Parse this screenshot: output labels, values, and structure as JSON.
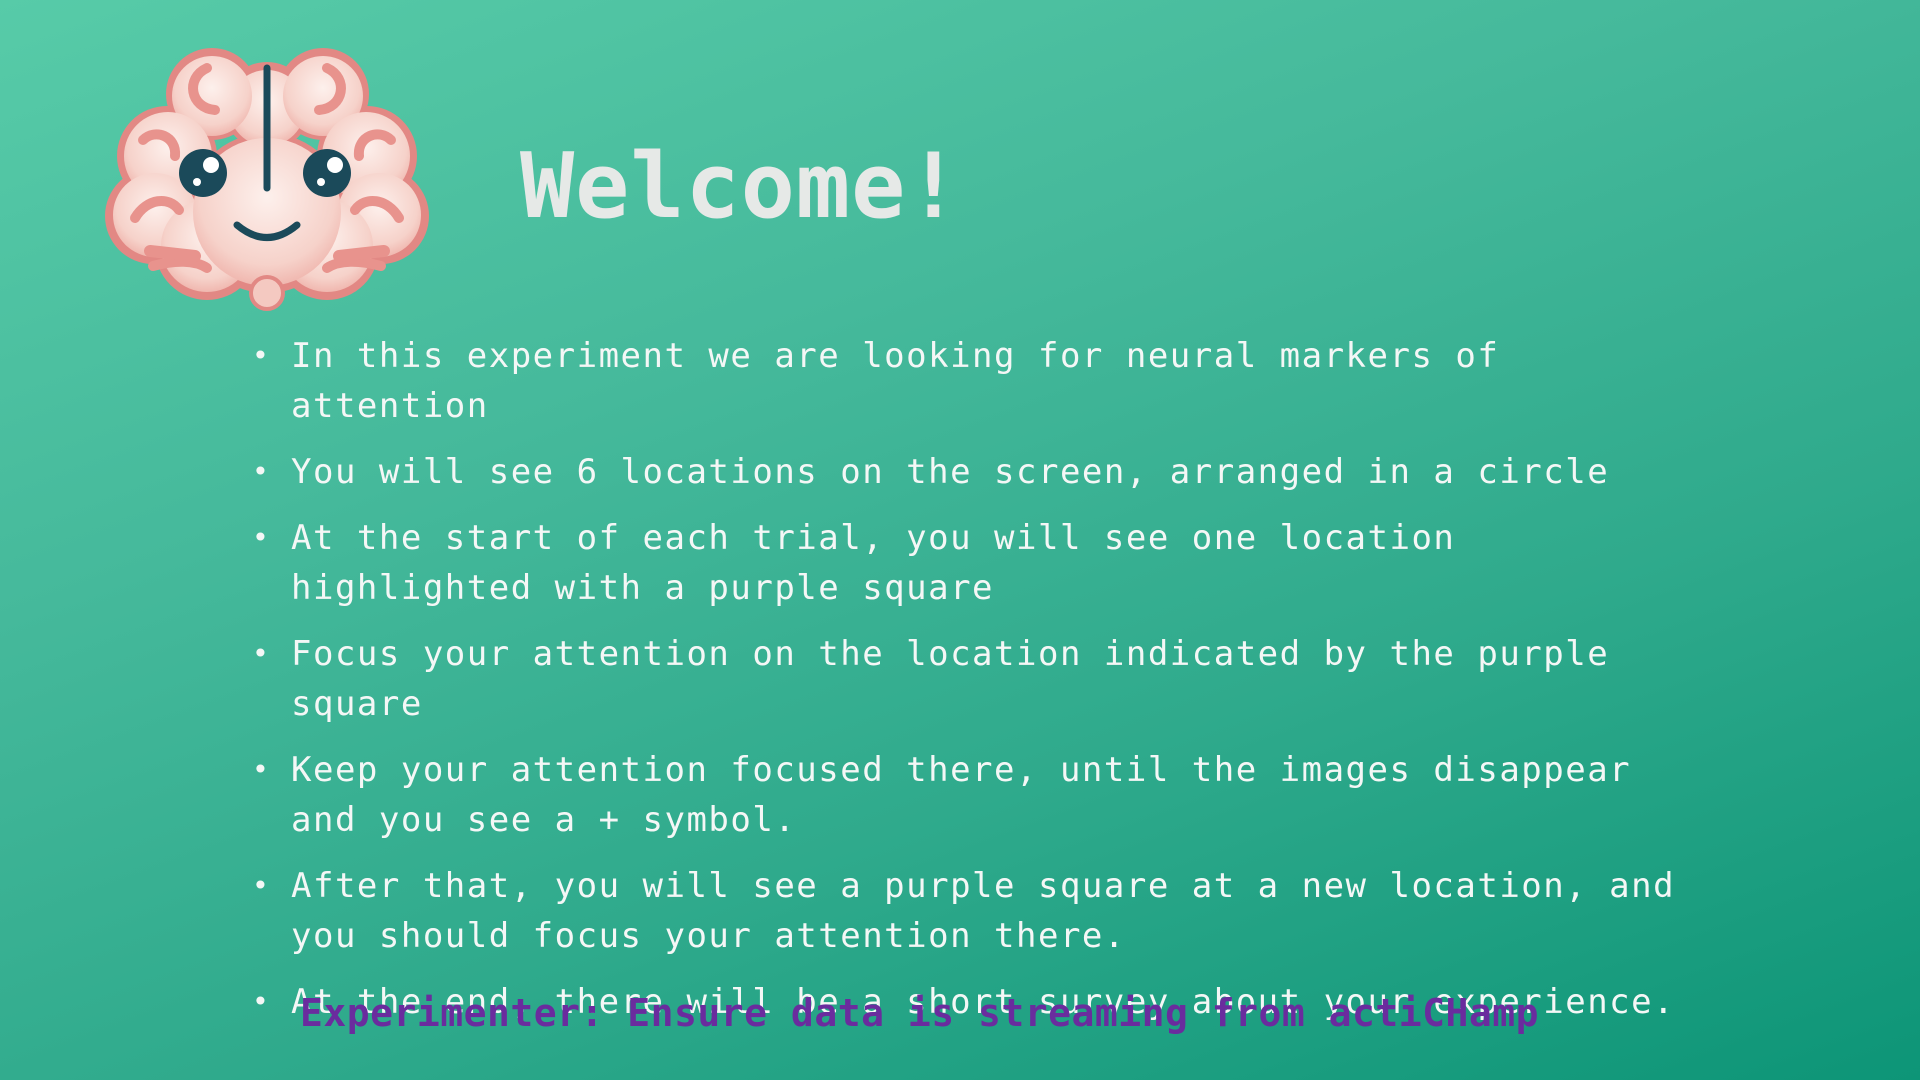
{
  "page": {
    "title": "Welcome!",
    "mascot_icon": "brain-mascot-icon",
    "instructions": [
      {
        "text": "In this experiment we are looking for neural markers of attention"
      },
      {
        "text": "You will see 6 locations on the screen, arranged in a circle"
      },
      {
        "text": "At the start of each trial, you will see one location highlighted with a purple square"
      },
      {
        "text": "Focus your attention on the location indicated by the purple square"
      },
      {
        "text": "Keep your attention focused there, until the images disappear and you see a + symbol."
      },
      {
        "text": "After that, you will see a purple square at a new location, and you should focus your attention there."
      },
      {
        "text": "At the end, there will be a short survey about your experience."
      }
    ],
    "experimenter_notice": "Experimenter: Ensure data is streaming from actiCHamp"
  },
  "colors": {
    "background_start": "#57cba8",
    "background_end": "#0d9577",
    "title": "#e6e9e7",
    "body_text": "#f4f7f6",
    "notice": "#6a2c9e",
    "brain_fill": "#f6d6cf",
    "brain_outline": "#e07f7b",
    "eyes": "#1b4a5a"
  }
}
